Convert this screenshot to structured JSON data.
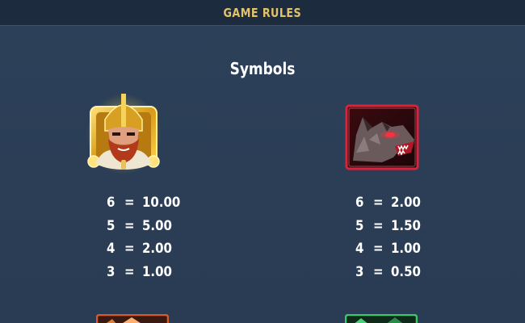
{
  "header": {
    "title": "GAME RULES"
  },
  "section": {
    "title": "Symbols"
  },
  "symbols": [
    {
      "icon": "viking-warrior-icon",
      "payouts": [
        {
          "count": "6",
          "eq": "=",
          "value": "10.00"
        },
        {
          "count": "5",
          "eq": "=",
          "value": "5.00"
        },
        {
          "count": "4",
          "eq": "=",
          "value": "2.00"
        },
        {
          "count": "3",
          "eq": "=",
          "value": "1.00"
        }
      ]
    },
    {
      "icon": "wolf-icon",
      "payouts": [
        {
          "count": "6",
          "eq": "=",
          "value": "2.00"
        },
        {
          "count": "5",
          "eq": "=",
          "value": "1.50"
        },
        {
          "count": "4",
          "eq": "=",
          "value": "1.00"
        },
        {
          "count": "3",
          "eq": "=",
          "value": "0.50"
        }
      ]
    }
  ],
  "colors": {
    "header_bg": "#1c2b3d",
    "header_text": "#e3c36a",
    "page_bg": "#2b3e55",
    "gold": "#f0c040",
    "wolf_red": "#c0182c"
  }
}
